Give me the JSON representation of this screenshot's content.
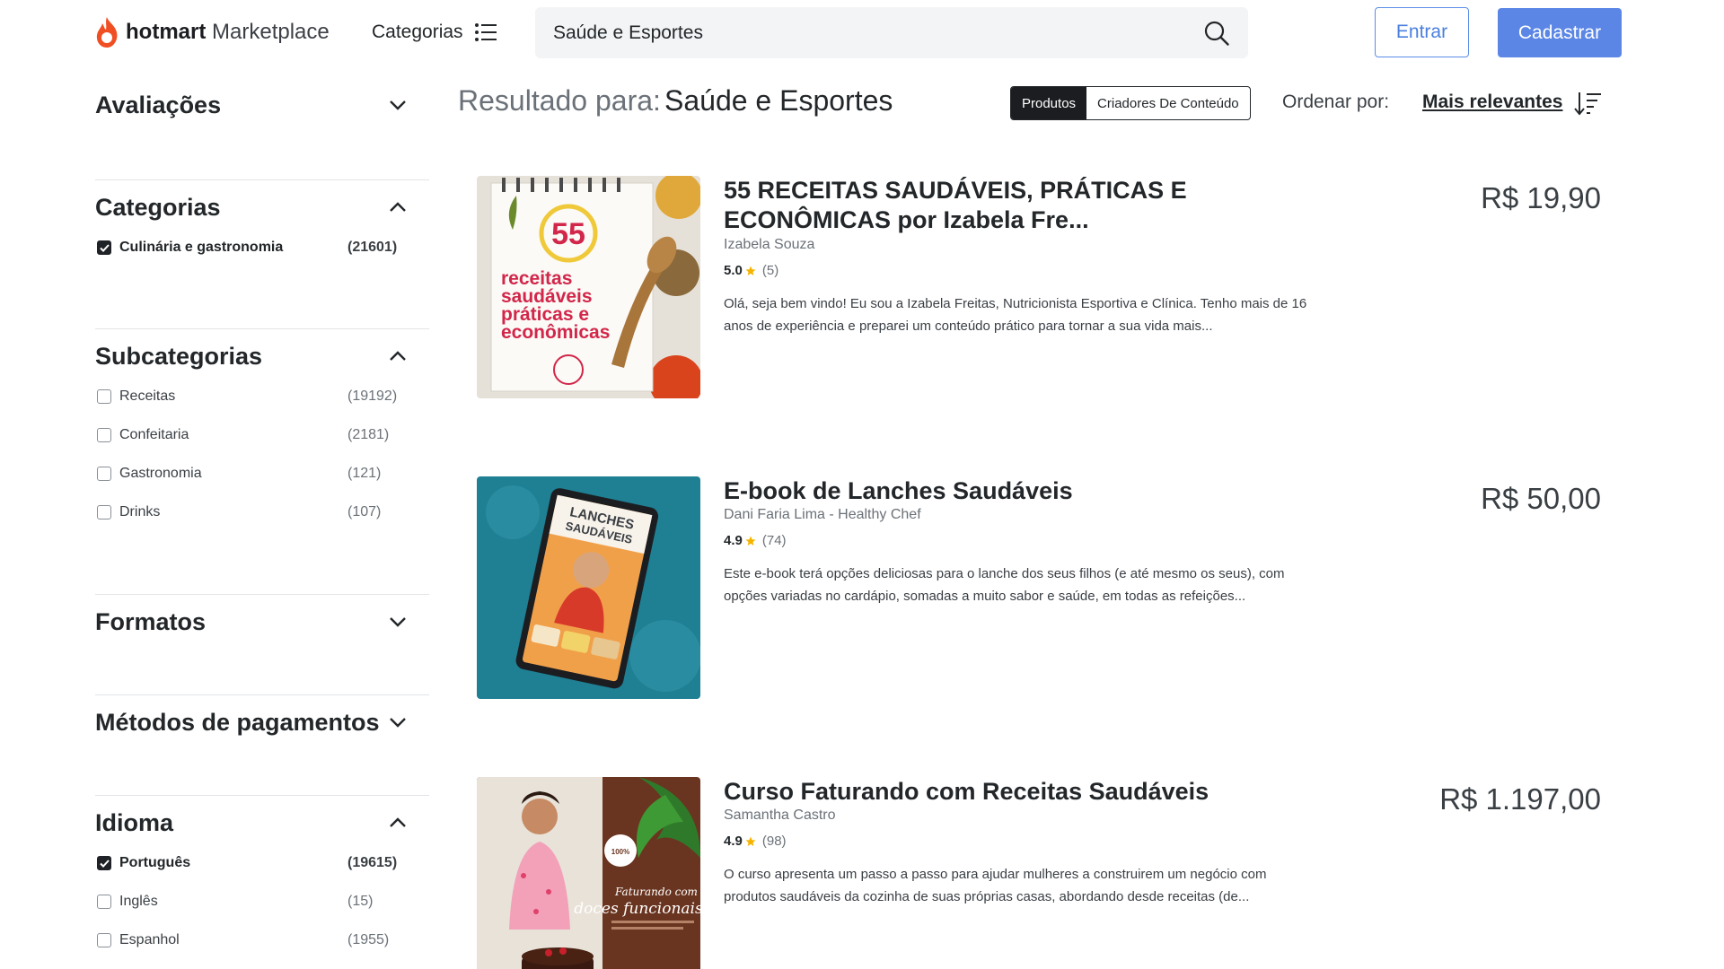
{
  "header": {
    "logo_brand": "hotmart",
    "logo_product": "Marketplace",
    "categories_label": "Categorias",
    "search_value": "Saúde e Esportes",
    "login_label": "Entrar",
    "signup_label": "Cadastrar",
    "accent_color": "#5b86e5",
    "brand_color": "#f04e23"
  },
  "sidebar": {
    "reviews_title": "Avaliações",
    "categories": {
      "title": "Categorias",
      "options": [
        {
          "label": "Culinária e gastronomia",
          "count": "(21601)",
          "checked": true
        }
      ]
    },
    "subcategories": {
      "title": "Subcategorias",
      "options": [
        {
          "label": "Receitas",
          "count": "(19192)",
          "checked": false
        },
        {
          "label": "Confeitaria",
          "count": "(2181)",
          "checked": false
        },
        {
          "label": "Gastronomia",
          "count": "(121)",
          "checked": false
        },
        {
          "label": "Drinks",
          "count": "(107)",
          "checked": false
        }
      ]
    },
    "formats_title": "Formatos",
    "payments_title": "Métodos de pagamentos",
    "language": {
      "title": "Idioma",
      "options": [
        {
          "label": "Português",
          "count": "(19615)",
          "checked": true
        },
        {
          "label": "Inglês",
          "count": "(15)",
          "checked": false
        },
        {
          "label": "Espanhol",
          "count": "(1955)",
          "checked": false
        }
      ]
    }
  },
  "results": {
    "prefix": "Resultado para:",
    "term": "Saúde e Esportes",
    "tab_products": "Produtos",
    "tab_creators": "Criadores De Conteúdo",
    "sort_label": "Ordenar por:",
    "sort_value": "Mais relevantes"
  },
  "products": [
    {
      "title": "55 RECEITAS SAUDÁVEIS, PRÁTICAS E ECONÔMICAS por Izabela Fre...",
      "author": "Izabela Souza",
      "rating": "5.0",
      "reviews": "(5)",
      "description": "Olá, seja bem vindo! Eu sou a Izabela Freitas, Nutricionista Esportiva e Clínica. Tenho mais de 16 anos de experiência e preparei um conteúdo prático para tornar a sua vida mais...",
      "price": "R$ 19,90",
      "cover": {
        "number": "55",
        "line1": "receitas",
        "line2": "saudáveis",
        "line3": "práticas e",
        "line4": "econômicas"
      }
    },
    {
      "title": "E-book de Lanches Saudáveis",
      "author": "Dani Faria Lima - Healthy Chef",
      "rating": "4.9",
      "reviews": "(74)",
      "description": "Este e-book terá opções deliciosas para o lanche dos seus filhos (e até mesmo os seus), com opções variadas no cardápio, somadas a muito sabor e saúde, em todas as refeições...",
      "price": "R$ 50,00",
      "cover": {
        "line1": "LANCHES",
        "line2": "SAUDÁVEIS"
      }
    },
    {
      "title": "Curso Faturando com Receitas Saudáveis",
      "author": "Samantha Castro",
      "rating": "4.9",
      "reviews": "(98)",
      "description": "O curso apresenta um passo a passo para ajudar mulheres a construirem um negócio com produtos saudáveis da cozinha de suas próprias casas, abordando desde receitas (de...",
      "price": "R$ 1.197,00",
      "cover": {
        "badge": "100%",
        "line1": "Faturando com",
        "line2": "doces funcionais"
      }
    }
  ]
}
